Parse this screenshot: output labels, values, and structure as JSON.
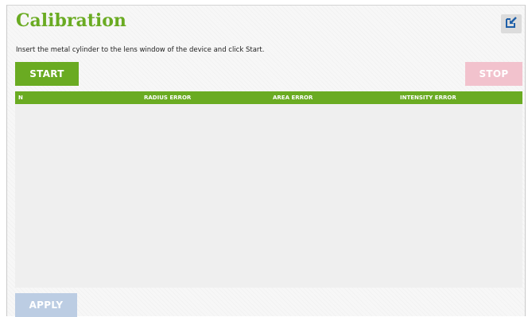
{
  "header": {
    "title": "Calibration",
    "export_icon": "export-icon"
  },
  "instructions": "Insert the metal cylinder to the lens window of the device and click Start.",
  "controls": {
    "start_label": "START",
    "stop_label": "STOP",
    "apply_label": "APPLY"
  },
  "table": {
    "columns": [
      "N",
      "RADIUS ERROR",
      "AREA ERROR",
      "INTENSITY ERROR"
    ],
    "rows": []
  },
  "colors": {
    "accent": "#6aab22",
    "stop_disabled": "#f2c2cd",
    "apply_disabled": "#bccde3"
  }
}
